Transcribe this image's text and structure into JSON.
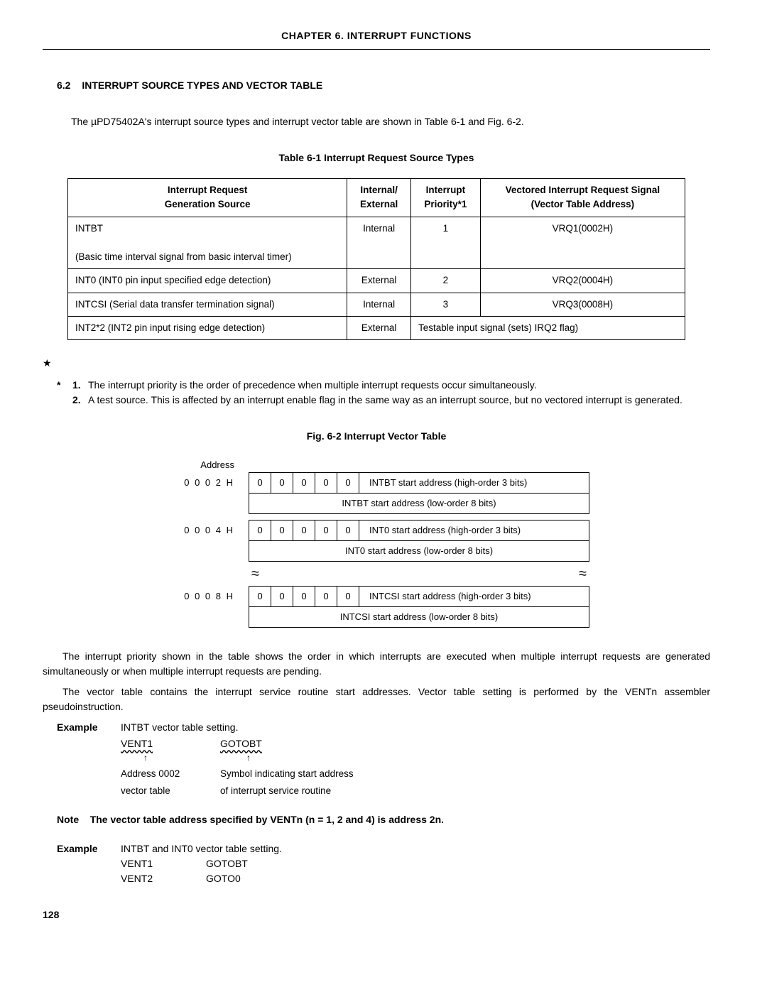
{
  "chapterHeader": "CHAPTER  6.   INTERRUPT  FUNCTIONS",
  "section": {
    "number": "6.2",
    "title": "INTERRUPT SOURCE TYPES AND VECTOR TABLE"
  },
  "intro": "The µPD75402A's interrupt source types and interrupt vector table are shown in Table 6-1 and Fig. 6-2.",
  "tableTitle": "Table 6-1 Interrupt Request Source Types",
  "tableHead": {
    "c1a": "Interrupt Request",
    "c1b": "Generation Source",
    "c2a": "Internal/",
    "c2b": "External",
    "c3a": "Interrupt",
    "c3b": "Priority*1",
    "c4a": "Vectored Interrupt Request Signal",
    "c4b": "(Vector Table Address)"
  },
  "tableRows": [
    {
      "src": "INTBT",
      "detail": "(Basic time interval signal from basic interval timer)",
      "ie": "Internal",
      "prio": "1",
      "vec": "VRQ1(0002H)"
    },
    {
      "src": "INT0 (INT0 pin input specified edge detection)",
      "detail": "",
      "ie": "External",
      "prio": "2",
      "vec": "VRQ2(0004H)"
    },
    {
      "src": "INTCSI (Serial data transfer termination signal)",
      "detail": "",
      "ie": "Internal",
      "prio": "3",
      "vec": "VRQ3(0008H)"
    }
  ],
  "tableLast": {
    "src": "INT2*2 (INT2 pin input rising edge detection)",
    "ie": "External",
    "merged": "Testable input signal (sets) IRQ2 flag)"
  },
  "footnotes": {
    "n1": "The interrupt priority is the order of precedence when multiple interrupt requests occur simultaneously.",
    "n2": "A test source. This is affected by an interrupt enable flag in the same way as an interrupt source, but no vectored interrupt is generated."
  },
  "figTitle": "Fig. 6-2 Interrupt Vector Table",
  "vt": {
    "addrLabel": "Address",
    "blocks": [
      {
        "addr": "0 0 0 2 H",
        "hi": "INTBT start address (high-order 3 bits)",
        "lo": "INTBT start address (low-order 8 bits)"
      },
      {
        "addr": "0 0 0 4 H",
        "hi": "INT0 start address (high-order 3 bits)",
        "lo": "INT0 start address (low-order 8 bits)"
      },
      {
        "addr": "0 0 0 8 H",
        "hi": "INTCSI start address (high-order 3 bits)",
        "lo": "INTCSI start address (low-order 8 bits)"
      }
    ],
    "bit": "0"
  },
  "body1": "The interrupt priority shown in the table shows the order in which interrupts are executed when multiple interrupt requests are generated simultaneously or when multiple interrupt requests are pending.",
  "body2": "The vector table contains the interrupt service routine start addresses. Vector table setting is performed by the VENTn assembler pseudoinstruction.",
  "example1": {
    "label": "Example",
    "lead": "INTBT vector table setting.",
    "w1": "VENT1",
    "w2": "GOTOBT",
    "arrow": "↑",
    "sub1a": "Address 0002",
    "sub1b": "vector table",
    "sub2a": "Symbol indicating start address",
    "sub2b": "of interrupt service routine"
  },
  "noteLine": {
    "label": "Note",
    "text": "The vector table address specified by VENTn (n = 1, 2 and 4) is address 2n."
  },
  "example2": {
    "label": "Example",
    "lead": "INTBT and INT0 vector table setting.",
    "r1a": "VENT1",
    "r1b": "GOTOBT",
    "r2a": "VENT2",
    "r2b": "GOTO0"
  },
  "pageNum": "128"
}
